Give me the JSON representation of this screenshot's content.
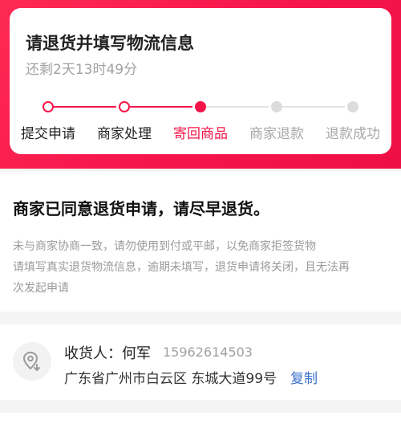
{
  "colors": {
    "accent": "#f5154a",
    "step_inactive": "#d6d6d6",
    "link": "#3a6fc9"
  },
  "header": {
    "title": "请退货并填写物流信息",
    "countdown": "还剩2天13时49分"
  },
  "progress": {
    "steps": [
      {
        "label": "提交申请",
        "state": "done"
      },
      {
        "label": "商家处理",
        "state": "done"
      },
      {
        "label": "寄回商品",
        "state": "current"
      },
      {
        "label": "商家退款",
        "state": "pending"
      },
      {
        "label": "退款成功",
        "state": "pending"
      }
    ],
    "current_step": 3
  },
  "notice": {
    "title": "商家已同意退货申请，请尽早退货。",
    "lines": [
      "未与商家协商一致，请勿使用到付或平邮，以免商家拒签货物",
      "请填写真实退货物流信息，逾期未填写，退货申请将关闭，且无法再",
      "次发起申请"
    ]
  },
  "address": {
    "icon": "location-pin-icon",
    "receiver_label": "收货人：何军",
    "phone": "15962614503",
    "full_address": "广东省广州市白云区 东城大道99号",
    "copy_label": "复制"
  }
}
